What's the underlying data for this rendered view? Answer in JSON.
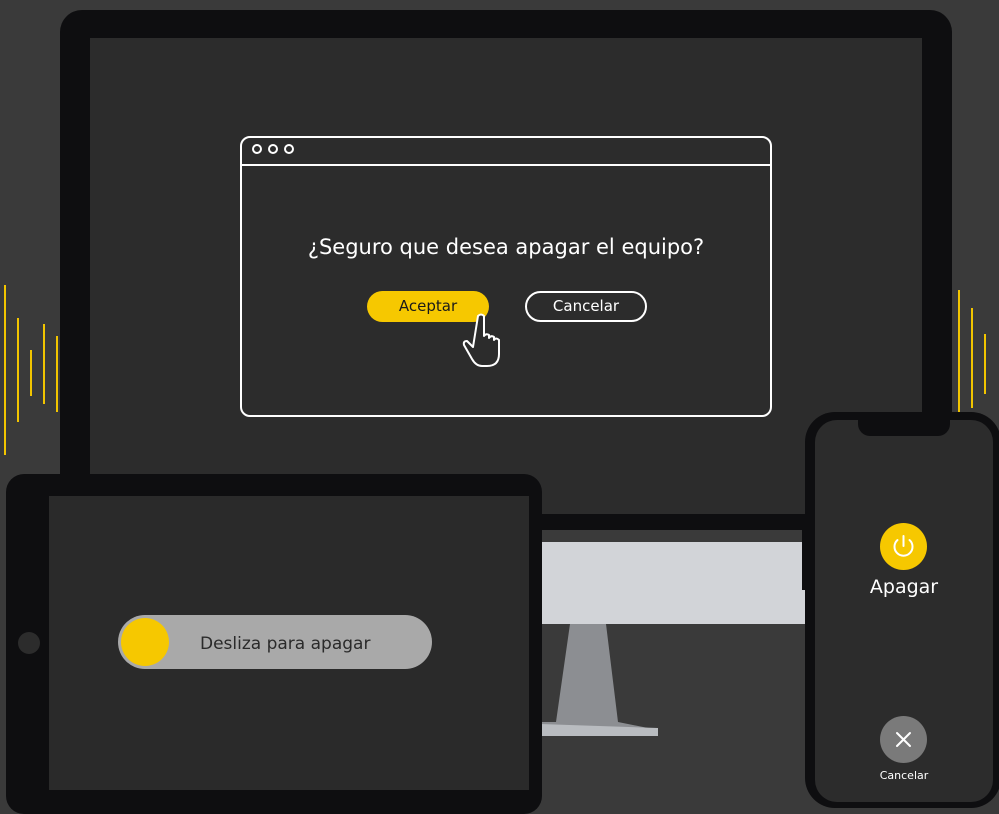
{
  "dialog": {
    "question": "¿Seguro que desea apagar el equipo?",
    "accept_label": "Aceptar",
    "cancel_label": "Cancelar"
  },
  "tablet": {
    "slider_label": "Desliza para apagar"
  },
  "phone": {
    "power_label": "Apagar",
    "cancel_label": "Cancelar"
  },
  "colors": {
    "accent": "#f6c800",
    "background": "#3a3a3a",
    "device_frame": "#0e0e10",
    "screen": "#2c2c2c"
  },
  "icons": [
    "window-dots-icon",
    "hand-cursor-icon",
    "power-icon",
    "close-icon",
    "sound-wave-icon"
  ]
}
